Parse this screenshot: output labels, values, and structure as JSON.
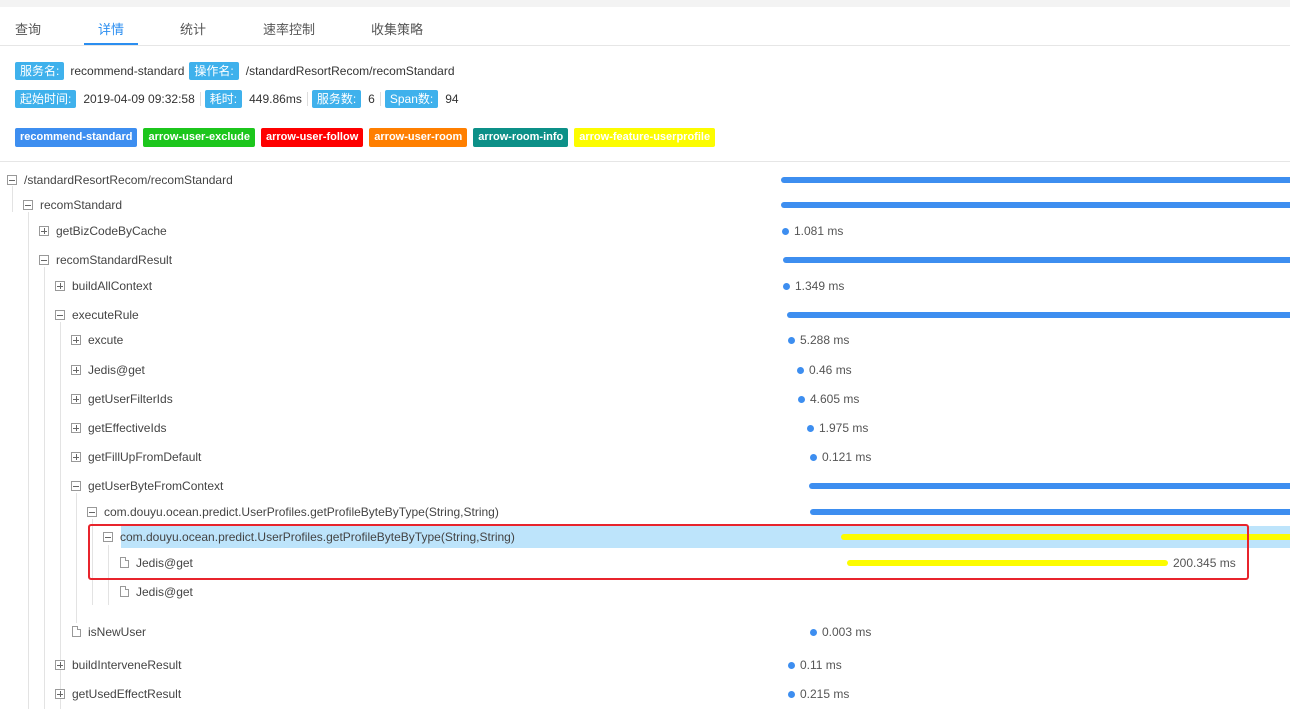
{
  "tabs": [
    "查询",
    "详情",
    "统计",
    "速率控制",
    "收集策略"
  ],
  "active_tab": "详情",
  "info": {
    "service_label": "服务名:",
    "service_value": "recommend-standard",
    "operation_label": "操作名:",
    "operation_value": "/standardResortRecom/recomStandard",
    "start_label": "起始时间:",
    "start_value": "2019-04-09 09:32:58",
    "duration_label": "耗时:",
    "duration_value": "449.86ms",
    "services_label": "服务数:",
    "services_value": "6",
    "spans_label": "Span数:",
    "spans_value": "94"
  },
  "legend": [
    {
      "name": "recommend-standard",
      "color": "#3d8ef0"
    },
    {
      "name": "arrow-user-exclude",
      "color": "#1cc61c"
    },
    {
      "name": "arrow-user-follow",
      "color": "#fe0000"
    },
    {
      "name": "arrow-user-room",
      "color": "#ff7f00"
    },
    {
      "name": "arrow-room-info",
      "color": "#0c9088"
    },
    {
      "name": "arrow-feature-userprofile",
      "color": "#fcfc00"
    }
  ],
  "spans": [
    {
      "label": "/standardResortRecom/recomStandard",
      "icon": "minus-square-icon",
      "level": 0,
      "duration": ""
    },
    {
      "label": "recomStandard",
      "icon": "minus-square-icon",
      "level": 1,
      "duration": ""
    },
    {
      "label": "getBizCodeByCache",
      "icon": "plus-square-icon",
      "level": 2,
      "duration": "1.081 ms"
    },
    {
      "label": "recomStandardResult",
      "icon": "minus-square-icon",
      "level": 2,
      "duration": ""
    },
    {
      "label": "buildAllContext",
      "icon": "plus-square-icon",
      "level": 3,
      "duration": "1.349 ms"
    },
    {
      "label": "executeRule",
      "icon": "minus-square-icon",
      "level": 3,
      "duration": ""
    },
    {
      "label": "excute",
      "icon": "plus-square-icon",
      "level": 4,
      "duration": "5.288 ms"
    },
    {
      "label": "Jedis@get",
      "icon": "plus-square-icon",
      "level": 4,
      "duration": "0.46 ms"
    },
    {
      "label": "getUserFilterIds",
      "icon": "plus-square-icon",
      "level": 4,
      "duration": "4.605 ms"
    },
    {
      "label": "getEffectiveIds",
      "icon": "plus-square-icon",
      "level": 4,
      "duration": "1.975 ms"
    },
    {
      "label": "getFillUpFromDefault",
      "icon": "plus-square-icon",
      "level": 4,
      "duration": "0.121 ms"
    },
    {
      "label": "getUserByteFromContext",
      "icon": "minus-square-icon",
      "level": 4,
      "duration": ""
    },
    {
      "label": "com.douyu.ocean.predict.UserProfiles.getProfileByteByType(String,String)",
      "icon": "minus-square-icon",
      "level": 5,
      "duration": ""
    },
    {
      "label": "com.douyu.ocean.predict.UserProfiles.getProfileByteByType(String,String)",
      "icon": "minus-square-icon",
      "level": 6,
      "duration": "",
      "selected": true
    },
    {
      "label": "Jedis@get",
      "icon": "document-icon",
      "level": 7,
      "duration": "200.345 ms"
    },
    {
      "label": "Jedis@get",
      "icon": "document-icon",
      "level": 7,
      "duration": ""
    },
    {
      "label": "isNewUser",
      "icon": "document-icon",
      "level": 4,
      "duration": "0.003 ms"
    },
    {
      "label": "buildInterveneResult",
      "icon": "plus-square-icon",
      "level": 3,
      "duration": "0.11 ms"
    },
    {
      "label": "getUsedEffectResult",
      "icon": "plus-square-icon",
      "level": 3,
      "duration": "0.215 ms"
    }
  ]
}
